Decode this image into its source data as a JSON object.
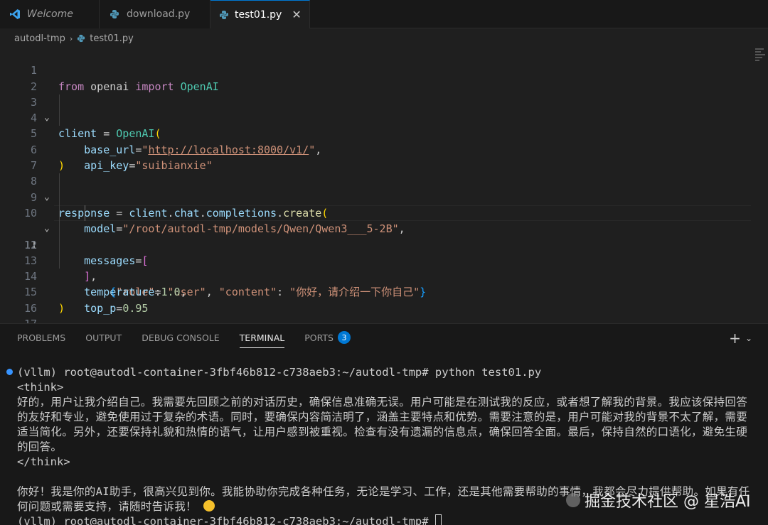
{
  "tabs": [
    {
      "label": "Welcome",
      "icon": "vscode-icon"
    },
    {
      "label": "download.py",
      "icon": "python-icon"
    },
    {
      "label": "test01.py",
      "icon": "python-icon",
      "close": "✕"
    }
  ],
  "breadcrumb": {
    "folder": "autodl-tmp",
    "sep": "›",
    "file": "test01.py"
  },
  "editor": {
    "line_numbers": [
      "1",
      "2",
      "3",
      "4",
      "5",
      "6",
      "7",
      "8",
      "9",
      "10",
      "11",
      "12",
      "13",
      "14",
      "15",
      "16",
      "17"
    ]
  },
  "panel": {
    "tabs": [
      "PROBLEMS",
      "OUTPUT",
      "DEBUG CONSOLE",
      "TERMINAL",
      "PORTS"
    ],
    "ports_badge": "3",
    "add": "+",
    "chevron": "⌄"
  },
  "terminal": {
    "prompt_cmd": "(vllm) root@autodl-container-3fbf46b812-c738aeb3:~/autodl-tmp# python test01.py",
    "think_open": "<think>",
    "think_text": "好的，用户让我介绍自己。我需要先回顾之前的对话历史，确保信息准确无误。用户可能是在测试我的反应，或者想了解我的背景。我应该保持回答的友好和专业，避免使用过于复杂的术语。同时，要确保内容简洁明了，涵盖主要特点和优势。需要注意的是，用户可能对我的背景不太了解，需要适当简化。另外，还要保持礼貌和热情的语气，让用户感到被重视。检查有没有遗漏的信息点，确保回答全面。最后，保持自然的口语化，避免生硬的回答。",
    "think_close": "</think>",
    "answer": "你好！我是你的AI助手，很高兴见到你。我能协助你完成各种任务，无论是学习、工作，还是其他需要帮助的事情，我都会尽力提供帮助。如果有任何问题或需要支持，请随时告诉我！",
    "prompt_end": "(vllm) root@autodl-container-3fbf46b812-c738aeb3:~/autodl-tmp# "
  },
  "watermark": "掘金技术社区 @ 星浩AI"
}
